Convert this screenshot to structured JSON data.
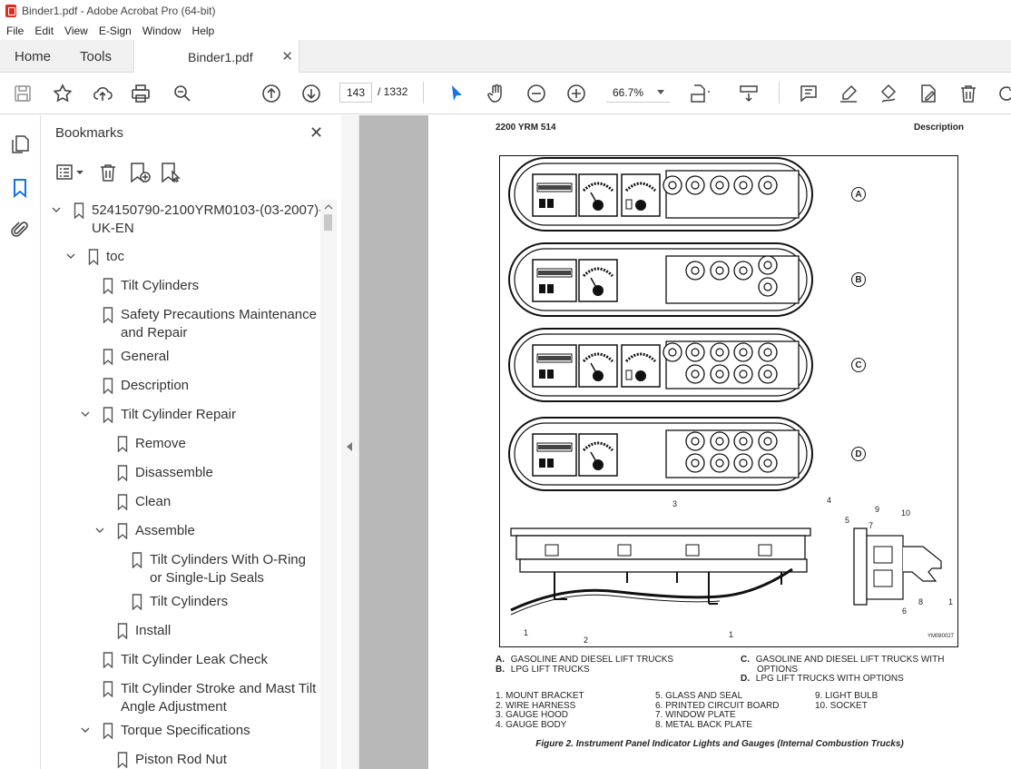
{
  "window": {
    "title": "Binder1.pdf - Adobe Acrobat Pro (64-bit)"
  },
  "menu": [
    "File",
    "Edit",
    "View",
    "E-Sign",
    "Window",
    "Help"
  ],
  "tabs": {
    "home": "Home",
    "tools": "Tools",
    "document": "Binder1.pdf"
  },
  "toolbar": {
    "page_current": "143",
    "page_total": "/  1332",
    "zoom": "66.7%"
  },
  "bookmarks": {
    "title": "Bookmarks",
    "items": [
      {
        "label": "524150790-2100YRM0103-(03-2007)-UK-EN",
        "line1": "524150790-2100YRM0103-(03-2007)-",
        "line2": "UK-EN",
        "level": 0,
        "expanded": true
      },
      {
        "label": "toc",
        "line1": "toc",
        "level": 1,
        "expanded": true
      },
      {
        "label": "Tilt Cylinders",
        "line1": "Tilt Cylinders",
        "level": 2
      },
      {
        "label": "Safety Precautions Maintenance and Repair",
        "line1": "Safety Precautions Maintenance",
        "line2": "and Repair",
        "level": 2
      },
      {
        "label": "General",
        "line1": "General",
        "level": 2
      },
      {
        "label": "Description",
        "line1": "Description",
        "level": 2
      },
      {
        "label": "Tilt Cylinder Repair",
        "line1": "Tilt Cylinder Repair",
        "level": 2,
        "expanded": true
      },
      {
        "label": "Remove",
        "line1": "Remove",
        "level": 3
      },
      {
        "label": "Disassemble",
        "line1": "Disassemble",
        "level": 3
      },
      {
        "label": "Clean",
        "line1": "Clean",
        "level": 3
      },
      {
        "label": "Assemble",
        "line1": "Assemble",
        "level": 3,
        "expanded": true
      },
      {
        "label": "Tilt Cylinders With O-Ring or Single-Lip Seals",
        "line1": "Tilt Cylinders With O-Ring",
        "line2": "or Single-Lip Seals",
        "level": 4
      },
      {
        "label": "Tilt Cylinders",
        "line1": "Tilt Cylinders",
        "level": 4
      },
      {
        "label": "Install",
        "line1": "Install",
        "level": 3
      },
      {
        "label": "Tilt Cylinder Leak Check",
        "line1": "Tilt Cylinder Leak Check",
        "level": 2
      },
      {
        "label": "Tilt Cylinder Stroke and Mast Tilt Angle Adjustment",
        "line1": "Tilt Cylinder Stroke and Mast Tilt",
        "line2": "Angle Adjustment",
        "level": 2
      },
      {
        "label": "Torque Specifications",
        "line1": "Torque Specifications",
        "level": 2,
        "expanded": true
      },
      {
        "label": "Piston Rod Nut",
        "line1": "Piston Rod Nut",
        "level": 3
      }
    ]
  },
  "document": {
    "header_left": "2200 YRM 514",
    "header_right": "Description",
    "panel_letters": [
      "A",
      "B",
      "C",
      "D"
    ],
    "callouts": [
      "3",
      "4",
      "5",
      "9",
      "7",
      "10",
      "1",
      "2",
      "1",
      "8",
      "6",
      "1"
    ],
    "figure_code": "YM080027",
    "legend_left": [
      {
        "key": "A.",
        "text": "GASOLINE AND DIESEL LIFT TRUCKS"
      },
      {
        "key": "B.",
        "text": "LPG LIFT TRUCKS"
      }
    ],
    "legend_right": [
      {
        "key": "C.",
        "text": "GASOLINE AND DIESEL LIFT TRUCKS WITH"
      },
      {
        "key": "",
        "text": "OPTIONS"
      },
      {
        "key": "D.",
        "text": "LPG LIFT TRUCKS WITH OPTIONS"
      }
    ],
    "parts_col1": [
      "1.   MOUNT BRACKET",
      "2.   WIRE HARNESS",
      "3.   GAUGE HOOD",
      "4.   GAUGE BODY"
    ],
    "parts_col2": [
      "5.   GLASS AND SEAL",
      "6.   PRINTED CIRCUIT BOARD",
      "7.   WINDOW PLATE",
      "8.   METAL BACK PLATE"
    ],
    "parts_col3": [
      "9.   LIGHT BULB",
      "10. SOCKET"
    ],
    "figure_title": "Figure 2. Instrument Panel Indicator Lights and Gauges (Internal Combustion Trucks)"
  }
}
